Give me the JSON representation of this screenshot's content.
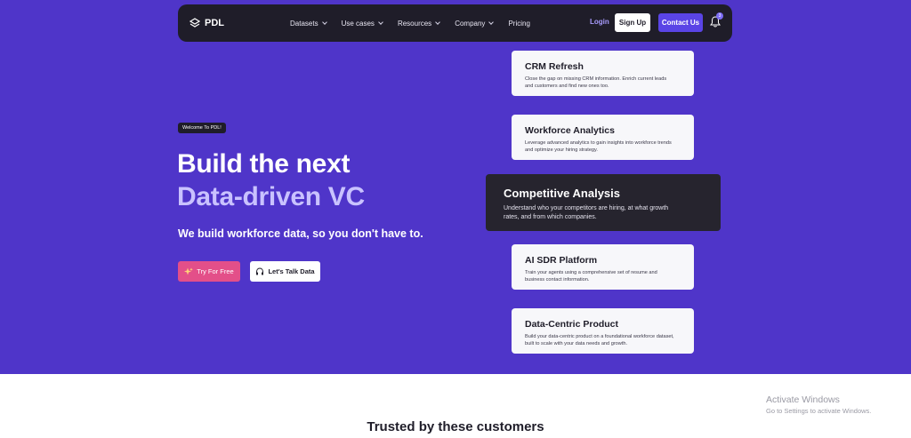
{
  "nav": {
    "logo_text": "PDL",
    "links": [
      {
        "label": "Datasets",
        "has_dropdown": true
      },
      {
        "label": "Use cases",
        "has_dropdown": true
      },
      {
        "label": "Resources",
        "has_dropdown": true
      },
      {
        "label": "Company",
        "has_dropdown": true
      },
      {
        "label": "Pricing",
        "has_dropdown": false
      }
    ],
    "login_label": "Login",
    "signup_label": "Sign Up",
    "contact_label": "Contact Us",
    "notification_count": "3"
  },
  "hero": {
    "welcome_badge": "Welcome To PDL!",
    "headline_line1": "Build the next",
    "headline_line2": "Data-driven VC",
    "subheadline": "We build workforce data, so you don't have to.",
    "cta_primary": "Try For Free",
    "cta_secondary": "Let's Talk Data"
  },
  "cards": [
    {
      "title": "CRM Refresh",
      "desc": "Close the gap on missing CRM information. Enrich current leads and customers and find new ones too."
    },
    {
      "title": "Workforce Analytics",
      "desc": "Leverage advanced analytics to gain insights into workforce trends and optimize your hiring strategy."
    },
    {
      "title": "Competitive Analysis",
      "desc": "Understand who your competitors are hiring, at what growth rates, and from which companies."
    },
    {
      "title": "AI SDR Platform",
      "desc": "Train your agents using a comprehensive set of resume and business contact information."
    },
    {
      "title": "Data-Centric Product",
      "desc": "Build your data-centric product on a foundational workforce dataset, built to scale with your data needs and growth."
    }
  ],
  "trusted_heading": "Trusted by these customers",
  "os_watermark": {
    "line1": "Activate Windows",
    "line2": "Go to Settings to activate Windows."
  },
  "colors": {
    "hero_bg": "#4f35c9",
    "nav_bg": "#1f1d29",
    "accent": "#5a44e6",
    "pink_cta": "#e34f89",
    "headline_light": "#c9c2ff"
  }
}
